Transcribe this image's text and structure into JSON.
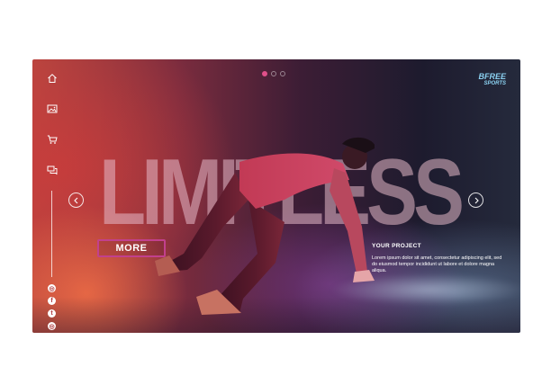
{
  "hero": {
    "headline": "LIMITLESS",
    "more_label": "MORE",
    "project_title": "YOUR PROJECT",
    "project_text": "Lorem ipsum dolor sit amet, consectetur adipiscing elit, sed do eiusmod tempor incididunt ut labore et dolore magna aliqua."
  },
  "logo": {
    "line1": "BFREE",
    "line2": "SPORTS"
  },
  "slider": {
    "dot_count": 3,
    "active_index": 0
  },
  "sidebar": {
    "icons": [
      "home-icon",
      "gallery-icon",
      "cart-icon",
      "chat-icon"
    ],
    "social": [
      {
        "icon": "instagram-icon",
        "glyph": "◎"
      },
      {
        "icon": "facebook-icon",
        "glyph": "f"
      },
      {
        "icon": "twitter-icon",
        "glyph": "t"
      },
      {
        "icon": "dribbble-icon",
        "glyph": "◎"
      }
    ]
  },
  "colors": {
    "accent": "#c2408d",
    "logo": "#8bd1f1",
    "active_dot": "#e0508a"
  }
}
